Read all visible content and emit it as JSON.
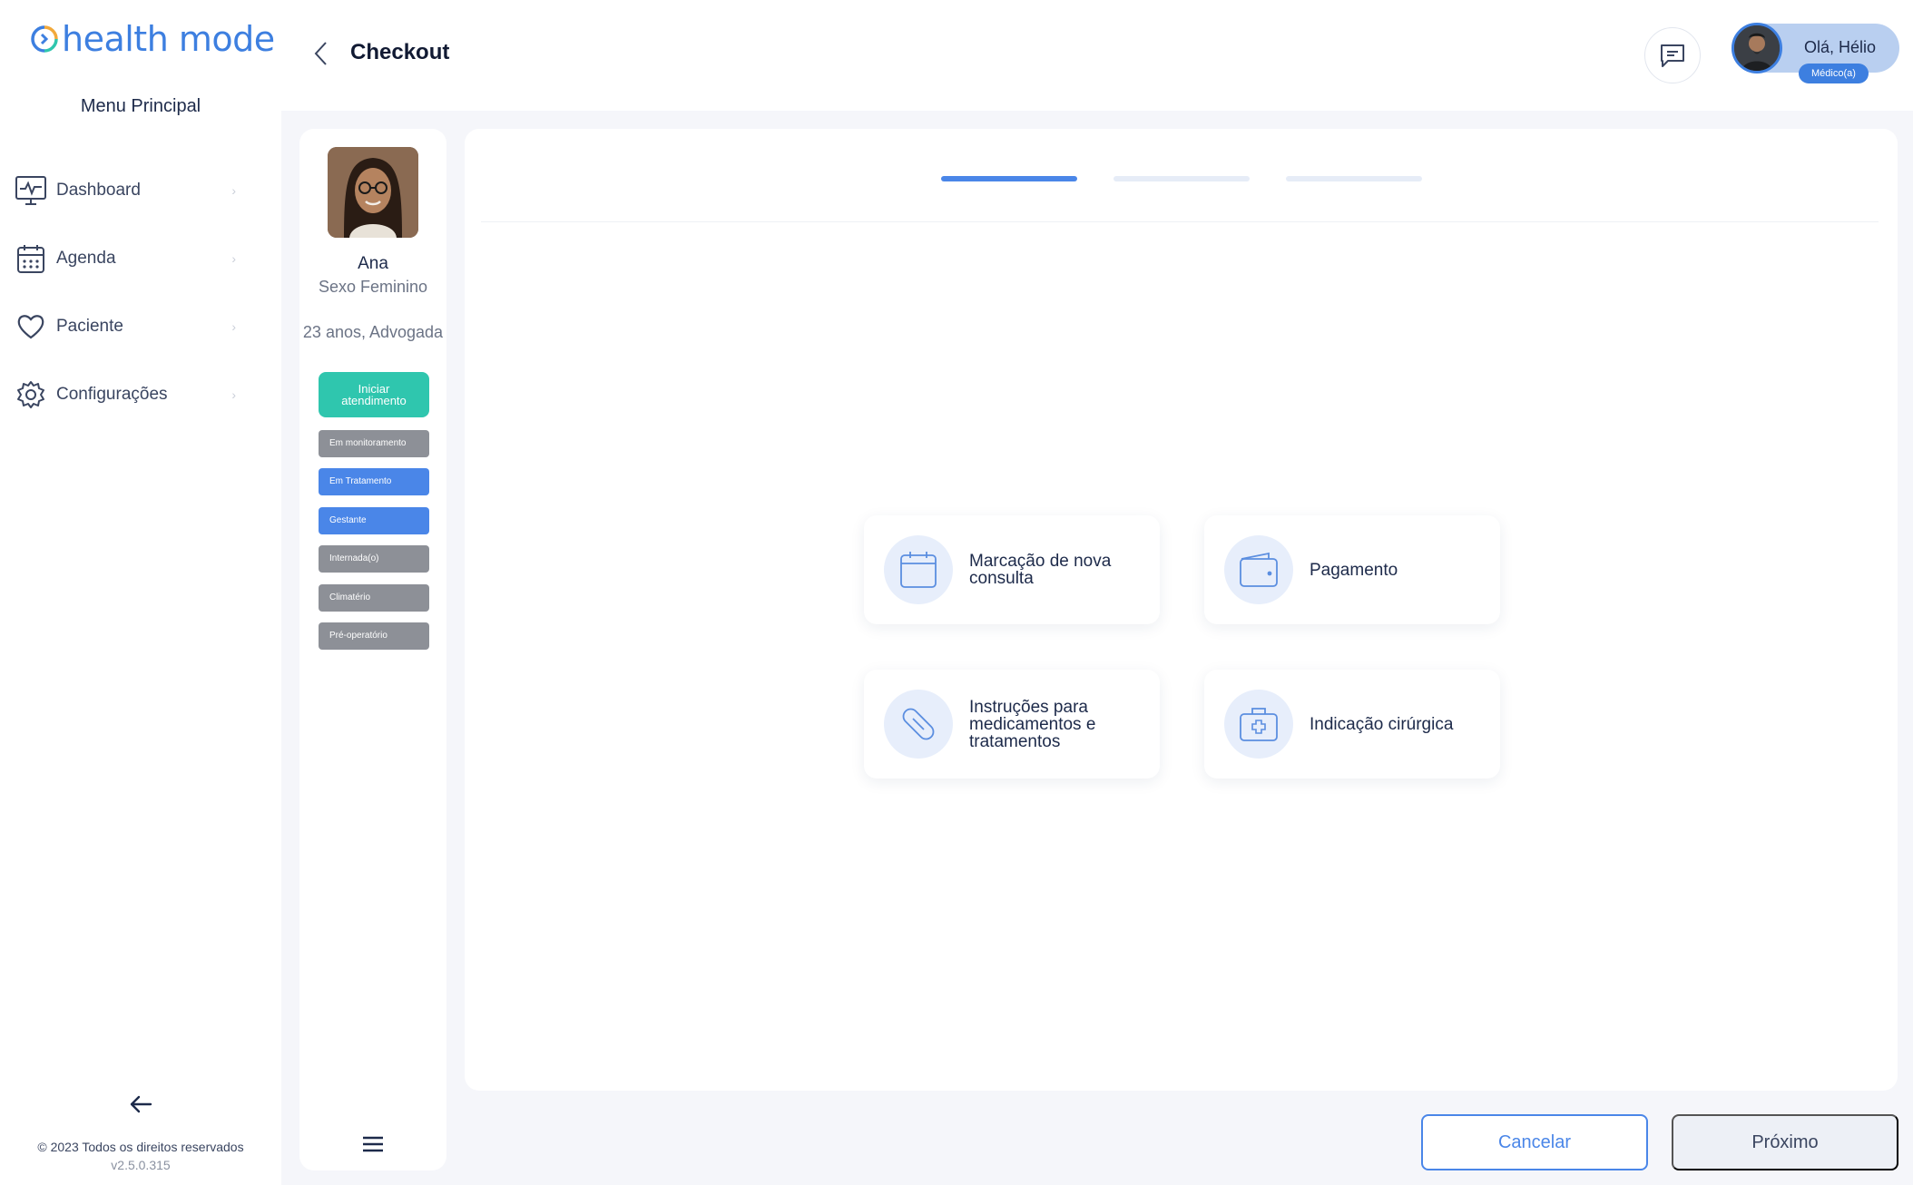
{
  "app": {
    "logo_text": "health mode",
    "brand_color": "#3d7fe0",
    "accent_color": "#2fc6ae"
  },
  "sidebar": {
    "menu_title": "Menu Principal",
    "items": [
      {
        "label": "Dashboard",
        "icon": "monitor-pulse-icon"
      },
      {
        "label": "Agenda",
        "icon": "calendar-icon"
      },
      {
        "label": "Paciente",
        "icon": "heart-icon"
      },
      {
        "label": "Configurações",
        "icon": "gear-icon"
      }
    ],
    "copyright": "© 2023 Todos os direitos reservados",
    "version": "v2.5.0.315"
  },
  "header": {
    "title": "Checkout",
    "greeting": "Olá, Hélio",
    "role": "Médico(a)"
  },
  "patient": {
    "name": "Ana",
    "sex": "Sexo Feminino",
    "age_job": "23 anos, Advogada",
    "start_button": "Iniciar atendimento",
    "tags": [
      {
        "label": "Em monitoramento",
        "active": false
      },
      {
        "label": "Em Tratamento",
        "active": true
      },
      {
        "label": "Gestante",
        "active": true
      },
      {
        "label": "Internada(o)",
        "active": false
      },
      {
        "label": "Climatério",
        "active": false
      },
      {
        "label": "Pré-operatório",
        "active": false
      }
    ]
  },
  "checkout": {
    "steps_total": 3,
    "current_step": 1,
    "options": [
      {
        "label": "Marcação de nova consulta",
        "icon": "calendar-icon"
      },
      {
        "label": "Pagamento",
        "icon": "wallet-icon"
      },
      {
        "label": "Instruções para medicamentos e tratamentos",
        "icon": "pill-icon"
      },
      {
        "label": "Indicação cirúrgica",
        "icon": "medical-kit-icon"
      }
    ]
  },
  "footer": {
    "cancel_label": "Cancelar",
    "next_label": "Próximo"
  }
}
